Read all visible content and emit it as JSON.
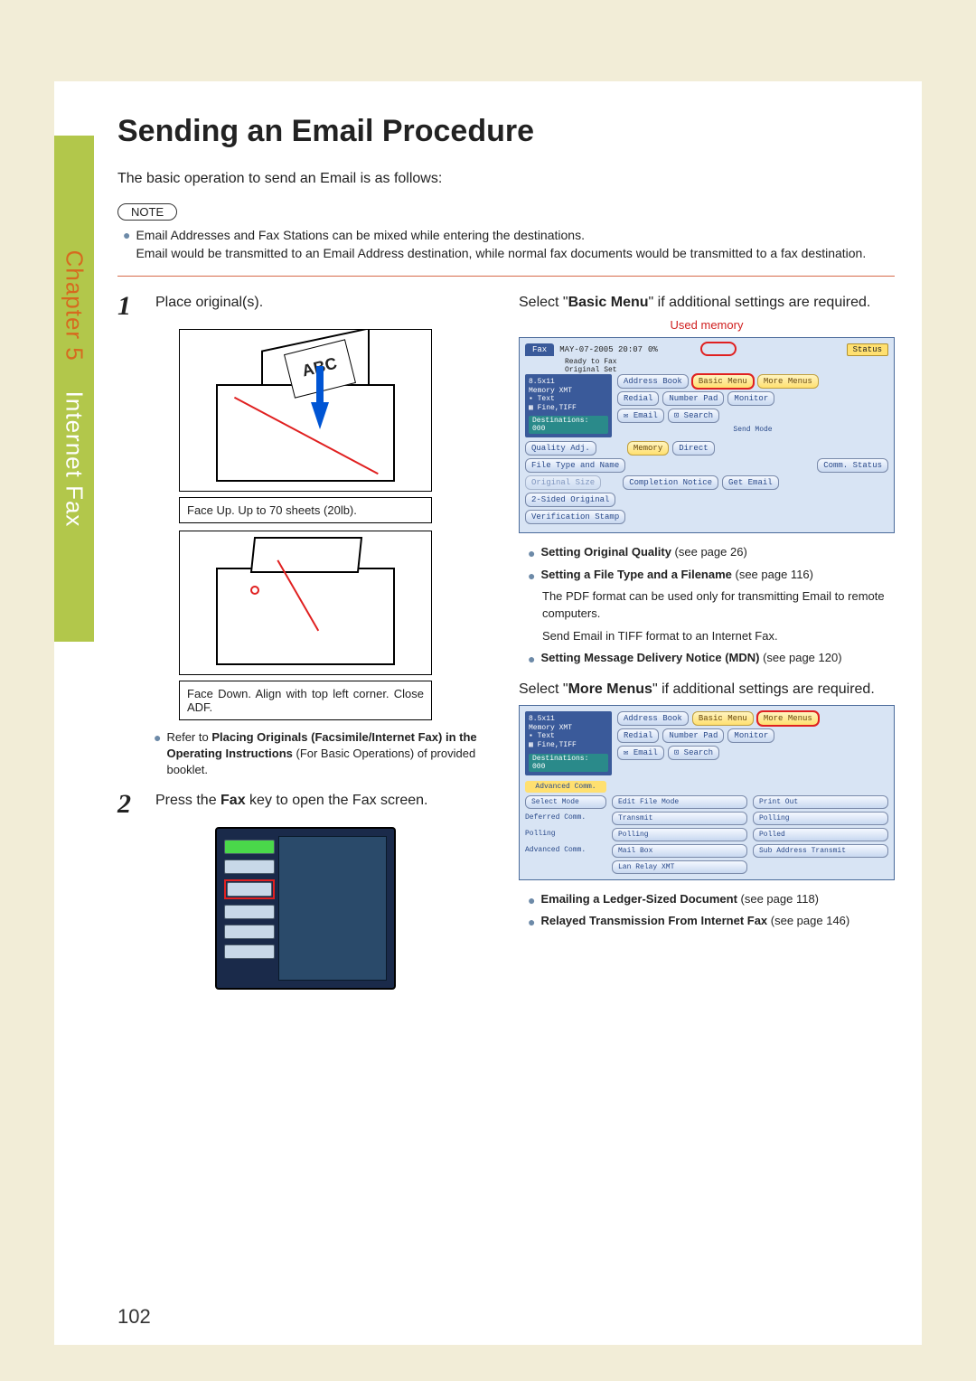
{
  "side_tab": {
    "chapter": "Chapter 5",
    "section": "Internet Fax"
  },
  "title": "Sending an Email Procedure",
  "intro": "The basic operation to send an Email is as follows:",
  "note_label": "NOTE",
  "note_body": "Email Addresses and Fax Stations can be mixed while entering the destinations.\nEmail would be transmitted to an Email Address destination, while normal fax documents would be transmitted to a fax destination.",
  "steps": {
    "s1_num": "1",
    "s1_text": "Place original(s).",
    "s2_num": "2",
    "s2a": "Press the ",
    "s2b": "Fax",
    "s2c": " key to open the Fax screen."
  },
  "abc": "ABC",
  "cap1": "Face Up. Up to 70 sheets (20lb).",
  "cap2": "Face Down. Align with top left corner. Close ADF.",
  "refer_a": "Refer to ",
  "refer_b": "Placing Originals (Facsimile/Internet Fax) in the Operating Instructions",
  "refer_c": " (For Basic Operations) of provided booklet.",
  "right": {
    "sel1a": "Select \"",
    "sel1b": "Basic Menu",
    "sel1c": "\" if additional settings are required.",
    "used_mem": "Used memory",
    "sel2a": "Select \"",
    "sel2b": "More Menus",
    "sel2c": "\" if additional settings are required.",
    "b1a": "Setting Original Quality",
    "b1b": " (see page 26)",
    "b2a": "Setting a File Type and a Filename",
    "b2b": " (see page 116)",
    "pdf_note": "The PDF format can be used only for transmitting Email to remote computers.",
    "tiff_note": "Send Email in TIFF format to an Internet Fax.",
    "b3a": "Setting Message Delivery Notice (MDN)",
    "b3b": " (see page 120)",
    "b4a": "Emailing a Ledger-Sized Document",
    "b4b": " (see page 118)",
    "b5a": "Relayed Transmission From Internet Fax",
    "b5b": " (see page 146)"
  },
  "fax": {
    "tab": "Fax",
    "date": "MAY-07-2005  20:07",
    "pct": "0%",
    "status": "Status",
    "ready": "Ready to Fax",
    "origset": "Original Set",
    "size": "8.5x11",
    "memxmt": "Memory XMT",
    "text": "Text",
    "fine": "Fine,TIFF",
    "dest": "Destinations: 000",
    "addr": "Address Book",
    "basic": "Basic Menu",
    "more": "More Menus",
    "redial": "Redial",
    "numpad": "Number Pad",
    "monitor": "Monitor",
    "email": "Email",
    "search": "Search",
    "sendmode": "Send Mode",
    "quality": "Quality Adj.",
    "memory": "Memory",
    "direct": "Direct",
    "ftype": "File Type and Name",
    "commstat": "Comm. Status",
    "origsize": "Original Size",
    "compnotice": "Completion Notice",
    "getemail": "Get Email",
    "twosided": "2-Sided Original",
    "verstamp": "Verification Stamp"
  },
  "more": {
    "adv": "Advanced Comm.",
    "selmode": "Select Mode",
    "editfile": "Edit File Mode",
    "printout": "Print Out",
    "deferred": "Deferred Comm.",
    "transmit": "Transmit",
    "polling_lbl": "Polling",
    "polling": "Polling",
    "polled": "Polled",
    "advcomm": "Advanced Comm.",
    "mailbox": "Mail Box",
    "subaddr": "Sub Address Transmit",
    "lanrelay": "Lan Relay XMT"
  },
  "page_num": "102"
}
